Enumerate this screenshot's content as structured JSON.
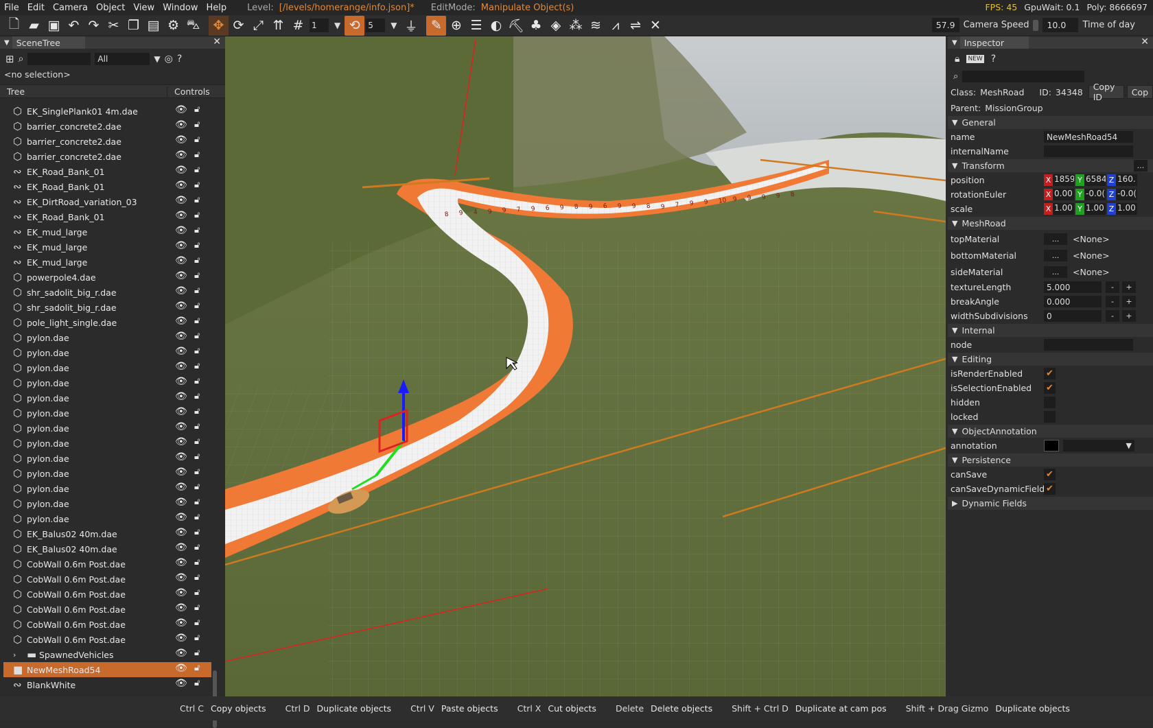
{
  "menu": {
    "items": [
      "File",
      "Edit",
      "Camera",
      "Object",
      "View",
      "Window",
      "Help"
    ],
    "level_label": "Level:",
    "level_value": "[/levels/homerange/info.json]*",
    "editmode_label": "EditMode:",
    "editmode_value": "Manipulate Object(s)",
    "fps": "FPS: 45",
    "gpuwait": "GpuWait: 0.1",
    "poly": "Poly: 8666697"
  },
  "toolbar": {
    "grid_value": "1",
    "rot_value": "5",
    "camera_speed_readout": "57.9",
    "camera_speed_label": "Camera Speed",
    "camera_speed_value": "10.0",
    "time_of_day_label": "Time of day"
  },
  "scenetree": {
    "title": "SceneTree",
    "filter_all": "All",
    "no_selection": "<no selection>",
    "col_tree": "Tree",
    "col_controls": "Controls",
    "rows": [
      {
        "name": "EK_SinglePlank01 4m.dae",
        "icon": "mesh-icon"
      },
      {
        "name": "barrier_concrete2.dae",
        "icon": "mesh-icon"
      },
      {
        "name": "barrier_concrete2.dae",
        "icon": "mesh-icon"
      },
      {
        "name": "barrier_concrete2.dae",
        "icon": "mesh-icon"
      },
      {
        "name": "EK_Road_Bank_01",
        "icon": "road-icon"
      },
      {
        "name": "EK_Road_Bank_01",
        "icon": "road-icon"
      },
      {
        "name": "EK_DirtRoad_variation_03",
        "icon": "road-icon"
      },
      {
        "name": "EK_Road_Bank_01",
        "icon": "road-icon"
      },
      {
        "name": "EK_mud_large",
        "icon": "road-icon"
      },
      {
        "name": "EK_mud_large",
        "icon": "road-icon"
      },
      {
        "name": "EK_mud_large",
        "icon": "road-icon"
      },
      {
        "name": "powerpole4.dae",
        "icon": "mesh-icon"
      },
      {
        "name": "shr_sadolit_big_r.dae",
        "icon": "mesh-icon"
      },
      {
        "name": "shr_sadolit_big_r.dae",
        "icon": "mesh-icon"
      },
      {
        "name": "pole_light_single.dae",
        "icon": "mesh-icon"
      },
      {
        "name": "pylon.dae",
        "icon": "mesh-icon"
      },
      {
        "name": "pylon.dae",
        "icon": "mesh-icon"
      },
      {
        "name": "pylon.dae",
        "icon": "mesh-icon"
      },
      {
        "name": "pylon.dae",
        "icon": "mesh-icon"
      },
      {
        "name": "pylon.dae",
        "icon": "mesh-icon"
      },
      {
        "name": "pylon.dae",
        "icon": "mesh-icon"
      },
      {
        "name": "pylon.dae",
        "icon": "mesh-icon"
      },
      {
        "name": "pylon.dae",
        "icon": "mesh-icon"
      },
      {
        "name": "pylon.dae",
        "icon": "mesh-icon"
      },
      {
        "name": "pylon.dae",
        "icon": "mesh-icon"
      },
      {
        "name": "pylon.dae",
        "icon": "mesh-icon"
      },
      {
        "name": "pylon.dae",
        "icon": "mesh-icon"
      },
      {
        "name": "pylon.dae",
        "icon": "mesh-icon"
      },
      {
        "name": "EK_Balus02 40m.dae",
        "icon": "mesh-icon"
      },
      {
        "name": "EK_Balus02 40m.dae",
        "icon": "mesh-icon"
      },
      {
        "name": "CobWall 0.6m Post.dae",
        "icon": "mesh-icon"
      },
      {
        "name": "CobWall 0.6m Post.dae",
        "icon": "mesh-icon"
      },
      {
        "name": "CobWall 0.6m Post.dae",
        "icon": "mesh-icon"
      },
      {
        "name": "CobWall 0.6m Post.dae",
        "icon": "mesh-icon"
      },
      {
        "name": "CobWall 0.6m Post.dae",
        "icon": "mesh-icon"
      },
      {
        "name": "CobWall 0.6m Post.dae",
        "icon": "mesh-icon"
      },
      {
        "name": "SpawnedVehicles",
        "icon": "folder-icon",
        "expandable": true
      },
      {
        "name": "NewMeshRoad54",
        "icon": "meshroad-icon",
        "selected": true
      },
      {
        "name": "BlankWhite",
        "icon": "road-icon"
      }
    ]
  },
  "inspector": {
    "title": "Inspector",
    "class_label": "Class:",
    "class_value": "MeshRoad",
    "id_label": "ID:",
    "id_value": "34348",
    "copy_id": "Copy ID",
    "copy_trunc": "Cop",
    "parent_label": "Parent:",
    "parent_value": "MissionGroup",
    "general": "General",
    "name_label": "name",
    "name_value": "NewMeshRoad54",
    "internalname_label": "internalName",
    "transform": "Transform",
    "position_label": "position",
    "pos": [
      "1859",
      "6584",
      "160."
    ],
    "rotation_label": "rotationEuler",
    "rot": [
      "0.00",
      "-0.0(",
      "-0.0("
    ],
    "scale_label": "scale",
    "scl": [
      "1.00",
      "1.00",
      "1.00"
    ],
    "meshroad": "MeshRoad",
    "topmat_label": "topMaterial",
    "bottommat_label": "bottomMaterial",
    "sidemat_label": "sideMaterial",
    "none": "<None>",
    "dots": "...",
    "texlen_label": "textureLength",
    "texlen_value": "5.000",
    "break_label": "breakAngle",
    "break_value": "0.000",
    "width_label": "widthSubdivisions",
    "width_value": "0",
    "internal": "Internal",
    "node_label": "node",
    "editing": "Editing",
    "isrender_label": "isRenderEnabled",
    "issel_label": "isSelectionEnabled",
    "hidden_label": "hidden",
    "locked_label": "locked",
    "objann": "ObjectAnnotation",
    "annotation_label": "annotation",
    "persistence": "Persistence",
    "cansave_label": "canSave",
    "cansavedyn_label": "canSaveDynamicFields",
    "dynamic": "Dynamic Fields",
    "minus": "-",
    "plus": "+",
    "x": "X",
    "y": "Y",
    "z": "Z",
    "ellipsis": "..."
  },
  "status": [
    {
      "key": "Ctrl C",
      "act": "Copy objects"
    },
    {
      "key": "Ctrl D",
      "act": "Duplicate objects"
    },
    {
      "key": "Ctrl V",
      "act": "Paste objects"
    },
    {
      "key": "Ctrl X",
      "act": "Cut objects"
    },
    {
      "key": "Delete",
      "act": "Delete objects"
    },
    {
      "key": "Shift + Ctrl D",
      "act": "Duplicate at cam pos"
    },
    {
      "key": "Shift + Drag Gizmo",
      "act": "Duplicate objects"
    }
  ],
  "colors": {
    "accent": "#c86a2c",
    "grass": "#5f6e3a",
    "road_edge": "#f07a35"
  },
  "viewport": {
    "road_markers": [
      "8",
      "9",
      "4",
      "9",
      "9",
      "7",
      "9",
      "6",
      "9",
      "8",
      "9",
      "6",
      "9",
      "9",
      "8",
      "9",
      "7",
      "9",
      "9",
      "10",
      "9",
      "9",
      "9",
      "9",
      "8"
    ]
  }
}
